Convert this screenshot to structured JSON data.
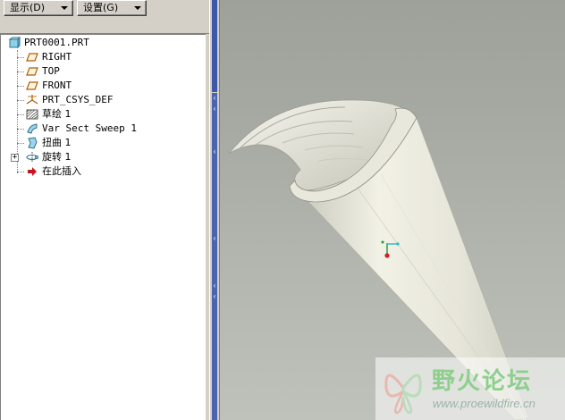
{
  "toolbar": {
    "display_label": "显示(D)",
    "settings_label": "设置(G)"
  },
  "model_tree": {
    "root": "PRT0001.PRT",
    "items": [
      {
        "label": "RIGHT",
        "icon": "datum-plane-icon"
      },
      {
        "label": "TOP",
        "icon": "datum-plane-icon"
      },
      {
        "label": "FRONT",
        "icon": "datum-plane-icon"
      },
      {
        "label": "PRT_CSYS_DEF",
        "icon": "coordinate-system-icon"
      },
      {
        "label": "草绘 1",
        "icon": "sketch-icon"
      },
      {
        "label": "Var Sect Sweep 1",
        "icon": "var-sect-sweep-icon"
      },
      {
        "label": "扭曲 1",
        "icon": "warp-icon"
      },
      {
        "label": "旋转 1",
        "icon": "revolve-icon",
        "expandable": true
      },
      {
        "label": "在此插入",
        "icon": "insert-here-arrow-icon"
      }
    ]
  },
  "watermark": {
    "title": "野火论坛",
    "url": "www.proewildfire.cn"
  },
  "colors": {
    "viewport_bg": "#a6aaa3",
    "model_color": "#f2f1e6",
    "panel_bg": "#d4d0c8",
    "splitter_accent": "#3c58a8",
    "insert_arrow": "#c8141e"
  }
}
